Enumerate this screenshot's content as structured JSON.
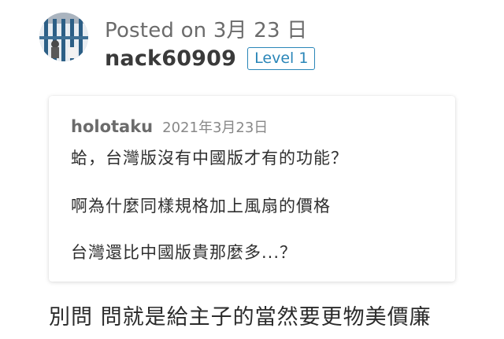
{
  "post": {
    "posted_label": "Posted on 3月 23 日",
    "author": "nack60909",
    "level_badge": "Level 1",
    "avatar_icon": "user-avatar-icon"
  },
  "quote": {
    "author": "holotaku",
    "date": "2021年3月23日",
    "lines": [
      "蛤，台灣版沒有中國版才有的功能？",
      "啊為什麼同樣規格加上風扇的價格",
      "台灣還比中國版貴那麼多...？"
    ]
  },
  "reply": {
    "text": "別問 問就是給主子的當然要更物美價廉"
  },
  "colors": {
    "badge_accent": "#2a86b8",
    "username": "#3a3a3a",
    "meta_gray": "#6b6b6b"
  }
}
